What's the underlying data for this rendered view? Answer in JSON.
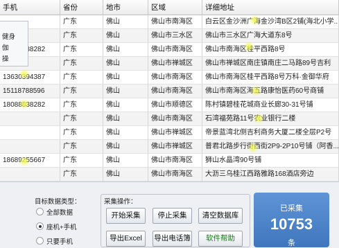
{
  "table": {
    "headers": [
      "手机",
      "省份",
      "地市",
      "区域",
      "详细地址"
    ],
    "rows": [
      {
        "phone": "",
        "prov": "广东",
        "city": "佛山",
        "dist": "佛山市南海区",
        "addr": "白云区金沙洲广海金沙湾B区2铺(海北小学..."
      },
      {
        "phone": "",
        "prov": "广东",
        "city": "佛山",
        "dist": "佛山市三水区",
        "addr": "佛山市三水区广海大道东8号"
      },
      {
        "phone": "18088838282",
        "prov": "广东",
        "city": "佛山",
        "dist": "佛山市南海区",
        "addr": "佛山市南海区桂平西路8号"
      },
      {
        "phone": "",
        "prov": "广东",
        "city": "佛山",
        "dist": "佛山市禅城区",
        "addr": "佛山市禅城区南庄镇南庄二马路89号吉利"
      },
      {
        "phone": "13630394387",
        "prov": "广东",
        "city": "佛山",
        "dist": "佛山市南海区",
        "addr": "佛山市南海区桂平西路8号万科·金御华府"
      },
      {
        "phone": "15118788596",
        "prov": "广东",
        "city": "佛山",
        "dist": "佛山市南海区",
        "addr": "佛山市南海区海五路康怡医药60号商铺"
      },
      {
        "phone": "18088838282",
        "prov": "广东",
        "city": "佛山",
        "dist": "佛山市顺德区",
        "addr": "陈村镇碧桂花城商业长廊30-31号铺"
      },
      {
        "phone": "",
        "prov": "广东",
        "city": "佛山",
        "dist": "佛山市南海区",
        "addr": "石湾福苑路11号农业银行二楼"
      },
      {
        "phone": "",
        "prov": "广东",
        "city": "佛山",
        "dist": "佛山市禅城区",
        "addr": "帝景蓝湾北侧吉利商务大厦二楼全层P2号"
      },
      {
        "phone": "",
        "prov": "广东",
        "city": "佛山",
        "dist": "佛山市禅城区",
        "addr": "普君北路步行街西街2P9-2P10号铺（阿香..."
      },
      {
        "phone": "18689255667",
        "prov": "广东",
        "city": "佛山",
        "dist": "佛山市南海区",
        "addr": "狮山水晶湾90号铺"
      },
      {
        "phone": "",
        "prov": "广东",
        "city": "佛山",
        "dist": "佛山市南海区",
        "addr": "大沥三乌桂江西路雅路168酒店旁边"
      }
    ]
  },
  "left_box": {
    "items": [
      "健身",
      "伽",
      "操"
    ]
  },
  "target": {
    "title": "目标数据类型：",
    "options": [
      "全部数据",
      "座机+手机",
      "只要手机"
    ],
    "selected_index": 1
  },
  "ops": {
    "title": "采集操作：",
    "buttons": [
      "开始采集",
      "停止采集",
      "清空数据库",
      "导出Excel",
      "导出电话簿",
      "软件帮助"
    ]
  },
  "counter": {
    "label": "已采集",
    "value": "10753",
    "unit": "条"
  },
  "colors": {
    "counter_bg": "#4a82c9",
    "highlight": "#f4fa50",
    "help_text": "#1b7a1b"
  }
}
